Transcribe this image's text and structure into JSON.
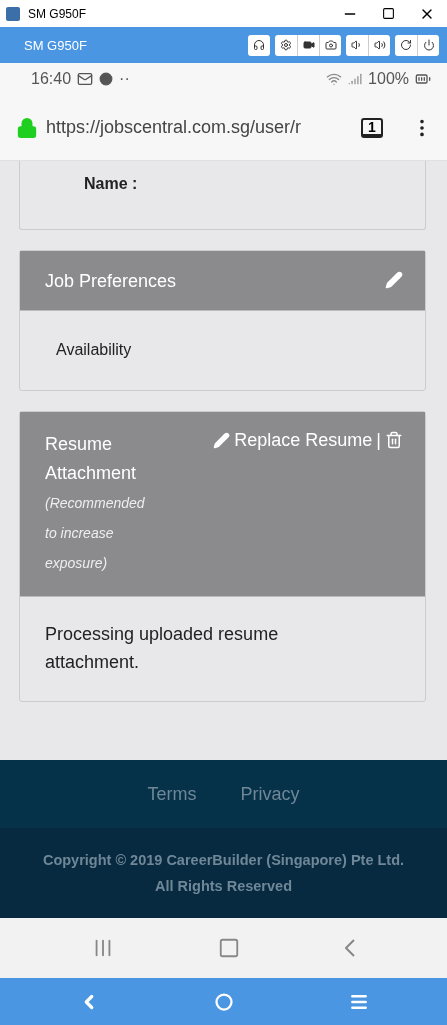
{
  "window": {
    "title": "SM G950F"
  },
  "toolbar": {
    "device": "SM G950F"
  },
  "status_bar": {
    "time": "16:40",
    "dots": "··",
    "battery": "100%"
  },
  "browser": {
    "url": "https://jobscentral.com.sg/user/r",
    "tabs_count": "1"
  },
  "cards": [
    {
      "kind": "field",
      "label": "Name :"
    },
    {
      "kind": "section",
      "title": "Job Preferences",
      "body": "Availability"
    },
    {
      "kind": "resume",
      "title": "Resume Attachment",
      "note": "(Recommended to increase exposure)",
      "action": "Replace Resume",
      "separator": "|",
      "body": "Processing uploaded resume attachment."
    }
  ],
  "footer": {
    "links": [
      "Terms",
      "Privacy"
    ],
    "copyright": "Copyright © 2019 CareerBuilder (Singapore) Pte Ltd. All Rights Reserved"
  }
}
